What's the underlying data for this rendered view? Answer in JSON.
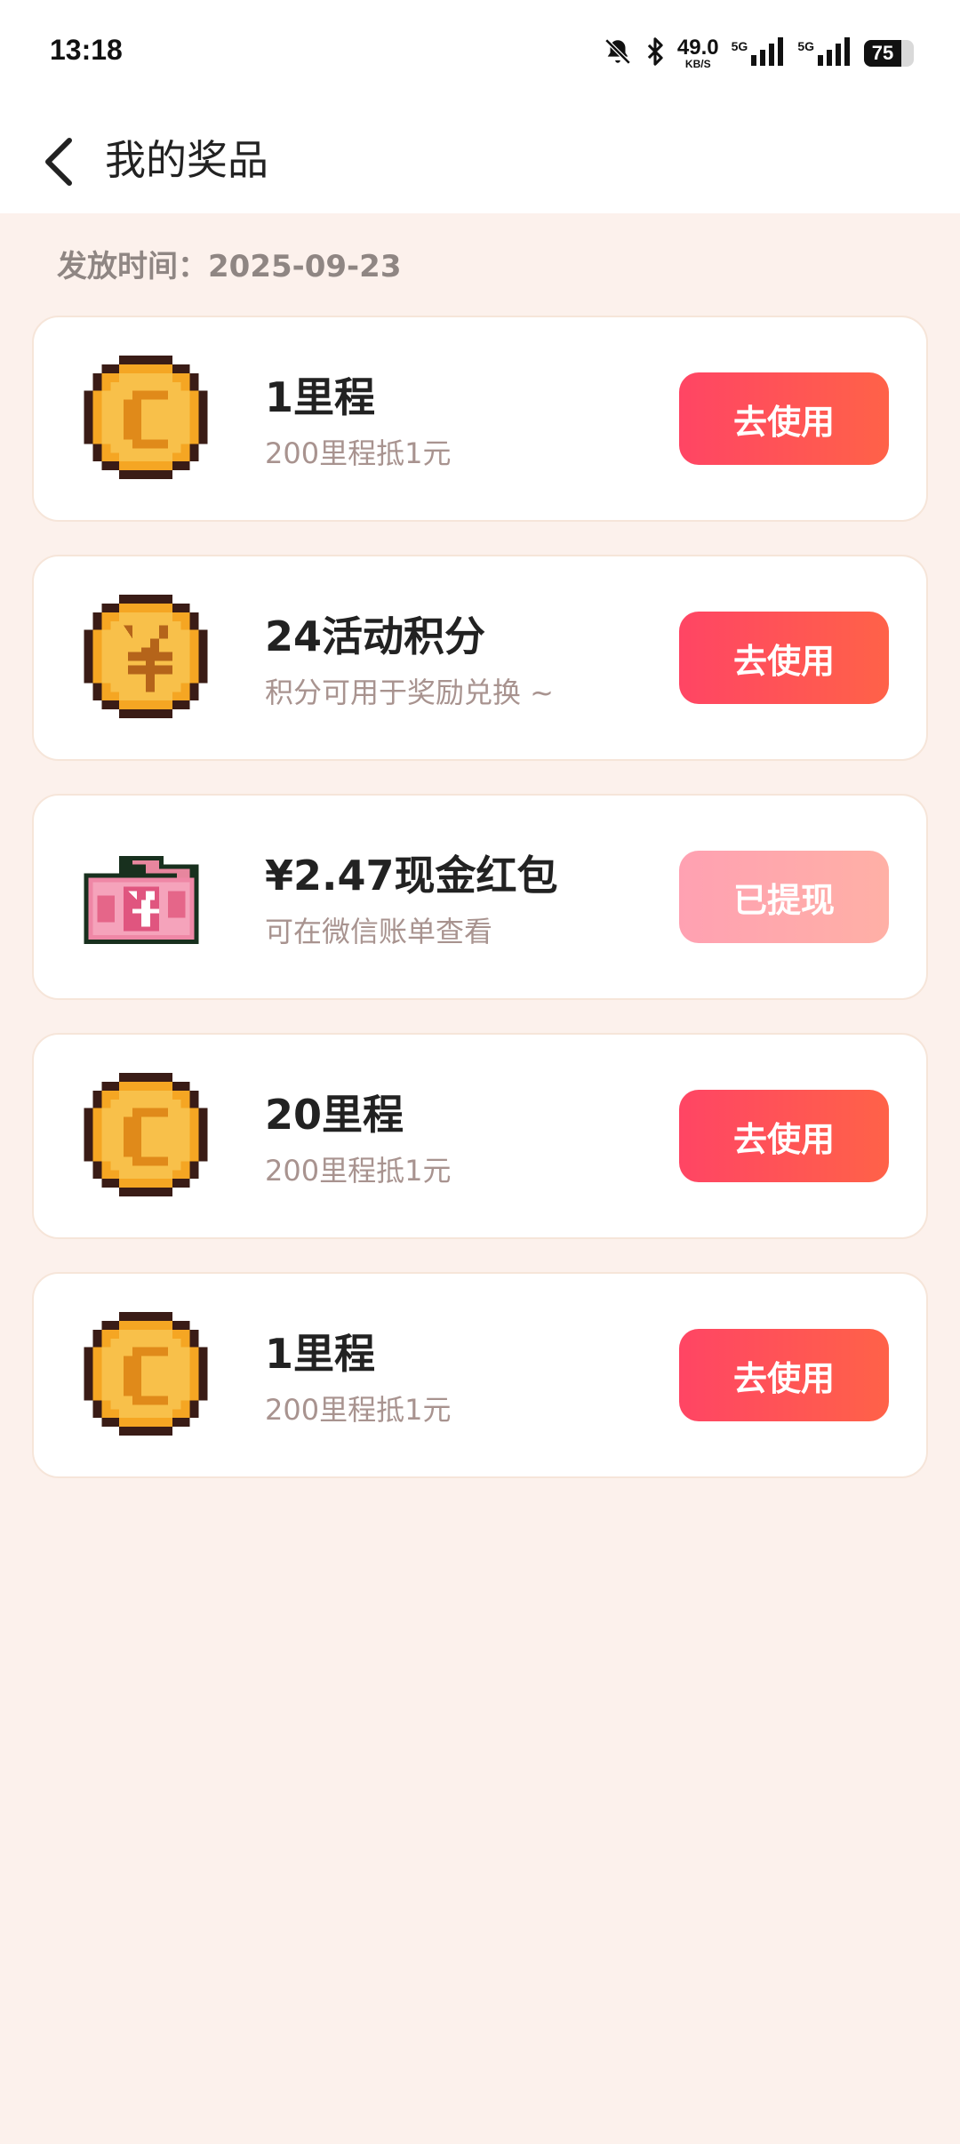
{
  "status_bar": {
    "time": "13:18",
    "net_speed": "49.0",
    "net_unit": "KB/S",
    "sim1_label": "5G",
    "sim2_label": "5G",
    "battery": "75"
  },
  "header": {
    "title": "我的奖品",
    "back_icon": "chevron-left-icon"
  },
  "issue_date": "发放时间：2025-09-23",
  "prizes": [
    {
      "title": "1里程",
      "subtitle": "200里程抵1元",
      "action": "去使用",
      "icon": "pixel-coin-c-icon",
      "enabled": true
    },
    {
      "title": "24活动积分",
      "subtitle": "积分可用于奖励兑换 ~",
      "action": "去使用",
      "icon": "pixel-coin-yen-icon",
      "enabled": true
    },
    {
      "title": "¥2.47现金红包",
      "subtitle": "可在微信账单查看",
      "action": "已提现",
      "icon": "pixel-cash-icon",
      "enabled": false
    },
    {
      "title": "20里程",
      "subtitle": "200里程抵1元",
      "action": "去使用",
      "icon": "pixel-coin-c-icon",
      "enabled": true
    },
    {
      "title": "1里程",
      "subtitle": "200里程抵1元",
      "action": "去使用",
      "icon": "pixel-coin-c-icon",
      "enabled": true
    }
  ],
  "colors": {
    "page_bg": "#fcf1ec",
    "button": "#ff4d5a",
    "button_disabled": "#ffa8b0",
    "coin": "#f7b83d"
  }
}
